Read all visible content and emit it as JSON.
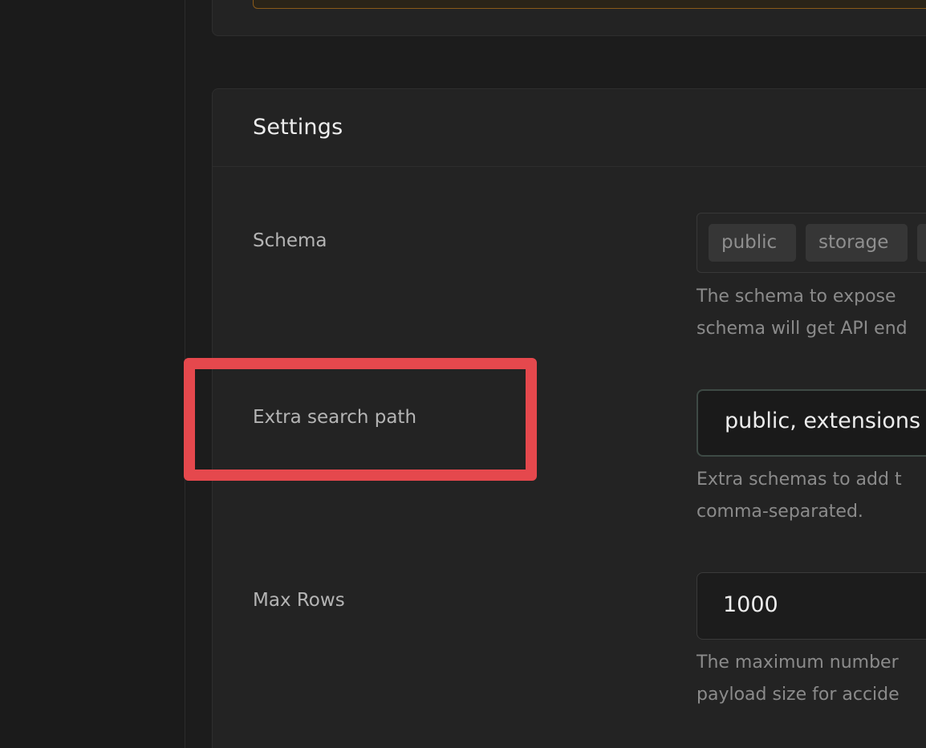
{
  "settings": {
    "title": "Settings",
    "schema": {
      "label": "Schema",
      "chips": [
        "public",
        "storage",
        ""
      ],
      "help_lines": [
        "The schema to expose",
        "schema will get API end"
      ]
    },
    "extra_search_path": {
      "label": "Extra search path",
      "value": "public, extensions",
      "help_lines": [
        "Extra schemas to add t",
        "comma-separated."
      ]
    },
    "max_rows": {
      "label": "Max Rows",
      "value": "1000",
      "help_lines": [
        "The maximum number",
        "payload size for accide"
      ]
    }
  },
  "colors": {
    "background": "#1c1c1c",
    "panel": "#232323",
    "highlight": "#e5484d",
    "text_primary": "#ededed",
    "text_secondary": "#b4b4b4",
    "text_muted": "#8b8b8b"
  }
}
